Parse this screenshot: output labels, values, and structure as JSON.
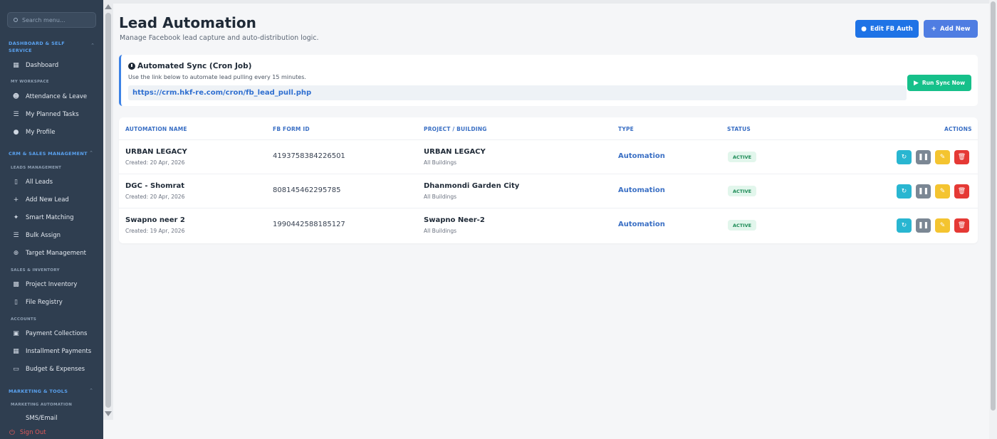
{
  "sidebar": {
    "search_placeholder": "Search menu...",
    "sections": {
      "dashboard": "DASHBOARD & SELF SERVICE",
      "crm": "CRM & SALES MANAGEMENT",
      "marketing": "MARKETING & TOOLS"
    },
    "subsections": {
      "workspace": "MY WORKSPACE",
      "leads": "LEADS MANAGEMENT",
      "sales": "SALES & INVENTORY",
      "accounts": "ACCOUNTS",
      "marketing_automation": "MARKETING AUTOMATION"
    },
    "items": [
      {
        "label": "Dashboard",
        "icon": "grid-icon"
      },
      {
        "label": "Attendance & Leave",
        "icon": "user-clock-icon"
      },
      {
        "label": "My Planned Tasks",
        "icon": "list-icon"
      },
      {
        "label": "My Profile",
        "icon": "user-circle-icon"
      },
      {
        "label": "All Leads",
        "icon": "file-icon"
      },
      {
        "label": "Add New Lead",
        "icon": "user-plus-icon"
      },
      {
        "label": "Smart Matching",
        "icon": "magic-icon"
      },
      {
        "label": "Bulk Assign",
        "icon": "layers-icon"
      },
      {
        "label": "Target Management",
        "icon": "crosshair-icon"
      },
      {
        "label": "Project Inventory",
        "icon": "building-icon"
      },
      {
        "label": "File Registry",
        "icon": "file-search-icon"
      },
      {
        "label": "Payment Collections",
        "icon": "money-icon"
      },
      {
        "label": "Installment Payments",
        "icon": "calendar-icon"
      },
      {
        "label": "Budget & Expenses",
        "icon": "wallet-icon"
      },
      {
        "label": "SMS/Email",
        "icon": "mail-icon"
      }
    ],
    "signout": "Sign Out"
  },
  "header": {
    "title": "Lead Automation",
    "subtitle": "Manage Facebook lead capture and auto-distribution logic.",
    "edit_fb_label": "Edit FB Auth",
    "add_new_label": "Add New"
  },
  "sync": {
    "title": "Automated Sync (Cron Job)",
    "description": "Use the link below to automate lead pulling every 15 minutes.",
    "url": "https://crm.hkf-re.com/cron/fb_lead_pull.php",
    "run_label": "Run Sync Now"
  },
  "table": {
    "headers": {
      "name": "AUTOMATION NAME",
      "form_id": "FB FORM ID",
      "project": "PROJECT / BUILDING",
      "type": "TYPE",
      "status": "STATUS",
      "actions": "ACTIONS"
    },
    "rows": [
      {
        "name": "URBAN LEGACY",
        "created": "Created: 20 Apr, 2026",
        "form_id": "4193758384226501",
        "project": "URBAN LEGACY",
        "building": "All Buildings",
        "type": "Automation",
        "status": "ACTIVE"
      },
      {
        "name": "DGC - Shomrat",
        "created": "Created: 20 Apr, 2026",
        "form_id": "808145462295785",
        "project": "Dhanmondi Garden City",
        "building": "All Buildings",
        "type": "Automation",
        "status": "ACTIVE"
      },
      {
        "name": "Swapno neer 2",
        "created": "Created: 19 Apr, 2026",
        "form_id": "1990442588185127",
        "project": "Swapno Neer-2",
        "building": "All Buildings",
        "type": "Automation",
        "status": "ACTIVE"
      }
    ]
  },
  "colors": {
    "sidebar_bg": "#2f3e50",
    "accent_blue": "#1e73e6",
    "success_green": "#16c08a",
    "danger_red": "#e53935"
  }
}
